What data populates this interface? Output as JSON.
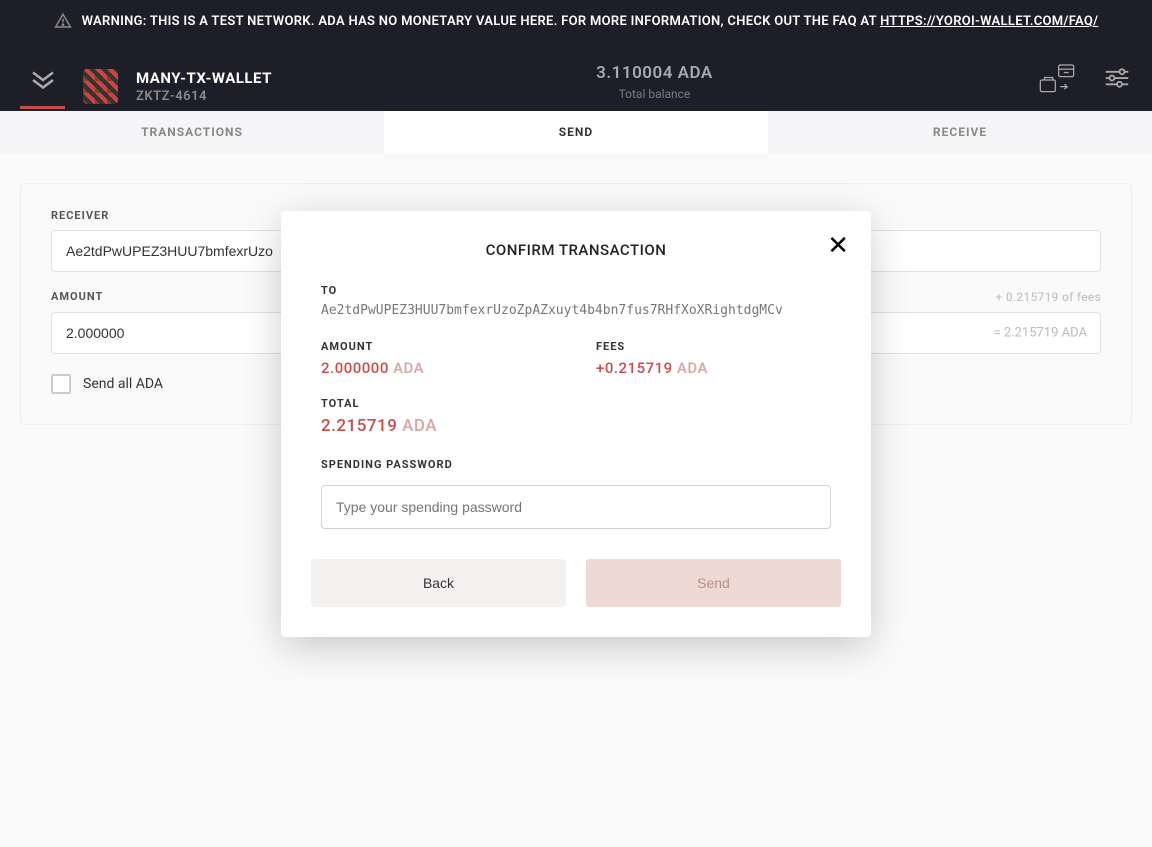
{
  "warning": {
    "prefix": "WARNING: THIS IS A TEST NETWORK. ADA HAS NO MONETARY VALUE HERE. FOR MORE INFORMATION, CHECK OUT THE FAQ AT ",
    "link": "HTTPS://YOROI-WALLET.COM/FAQ/"
  },
  "header": {
    "wallet_name": "MANY-TX-WALLET",
    "wallet_id": "ZKTZ-4614",
    "balance": "3.110004 ADA",
    "balance_label": "Total balance"
  },
  "tabs": {
    "transactions": "TRANSACTIONS",
    "send": "SEND",
    "receive": "RECEIVE"
  },
  "form": {
    "receiver_label": "RECEIVER",
    "receiver_value": "Ae2tdPwUPEZ3HUU7bmfexrUzo",
    "amount_label": "AMOUNT",
    "amount_value": "2.000000",
    "fee_note": "+ 0.215719 of fees",
    "amount_suffix": "= 2.215719 ADA",
    "send_all_label": "Send all ADA"
  },
  "modal": {
    "title": "CONFIRM TRANSACTION",
    "to_label": "TO",
    "to_value": "Ae2tdPwUPEZ3HUU7bmfexrUzoZpAZxuyt4b4bn7fus7RHfXoXRightdgMCv",
    "amount_label": "AMOUNT",
    "amount_value": "2.000000",
    "amount_unit": " ADA",
    "fees_label": "FEES",
    "fees_value": "+0.215719",
    "fees_unit": " ADA",
    "total_label": "TOTAL",
    "total_value": "2.215719",
    "total_unit": " ADA",
    "password_label": "SPENDING PASSWORD",
    "password_placeholder": "Type your spending password",
    "back_label": "Back",
    "send_label": "Send"
  }
}
